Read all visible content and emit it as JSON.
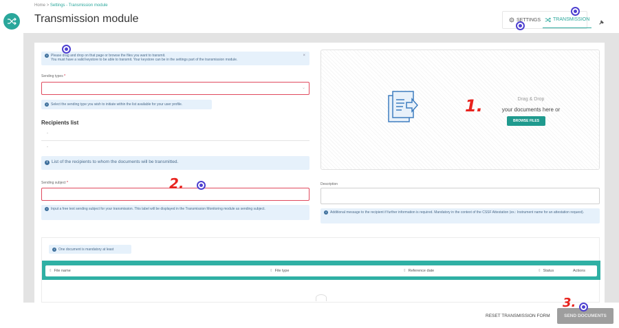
{
  "breadcrumb": {
    "home": "Home",
    "sep": ">",
    "current": "Settings - Transmission module"
  },
  "page_title": "Transmission module",
  "tabs": [
    {
      "label": "SETTINGS",
      "icon": "gear-icon"
    },
    {
      "label": "TRANSMISSION",
      "icon": "shuffle-icon"
    }
  ],
  "top_info": {
    "line1": "Please drag and drop on that page or browse the files you want to transmit.",
    "line2": "You must have a valid keystore to be able to transmit. Your keystore can be in the settings part of the transmission module.",
    "close": "×"
  },
  "sending_types": {
    "label": "Sending types",
    "required": "*",
    "help": "Select the sending type you wish to initiate within the list available for your user profile."
  },
  "recipients": {
    "title": "Recipients list",
    "items": [
      "-",
      "-"
    ],
    "help": "List of the recipients to whom the documents will be transmitted."
  },
  "dropzone": {
    "title": "Drag & Drop",
    "subtitle": "your documents here or",
    "browse": "BROWSE FILES"
  },
  "subject": {
    "label": "Sending subject",
    "required": "*",
    "help": "Input a free text sending subject for your transmission. This label will be displayed in the Transmission Monitoring module as sending subject."
  },
  "description": {
    "label": "Description",
    "help": "Additional message to the recipient if further information is required. Mandatory in the context of the CSSF Attestation (ex.: Instrument name for an attestation request)."
  },
  "documents": {
    "note": "One document is mandatory at least",
    "columns": [
      "File name",
      "File type",
      "Reference date",
      "Status",
      "Actions"
    ]
  },
  "footer": {
    "reset": "RESET TRANSMISSION FORM",
    "send": "SEND DOCUMENTS"
  },
  "annotations": {
    "step1": "1.",
    "step2": "2.",
    "step3": "3."
  },
  "colors": {
    "accent": "#2aa79b",
    "required": "#e0485c",
    "info_bg": "#e6f1fb",
    "marker": "#4d3fd0",
    "step": "#e8231e"
  }
}
